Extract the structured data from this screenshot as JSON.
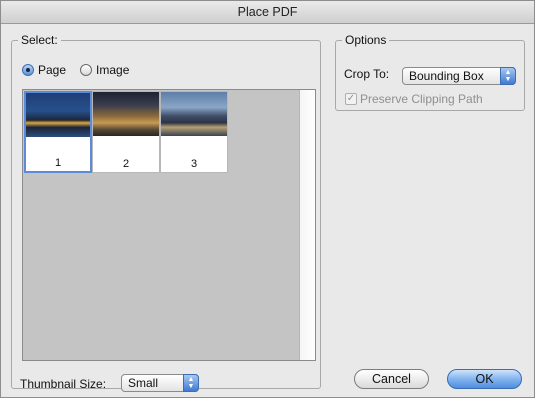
{
  "window": {
    "title": "Place PDF"
  },
  "select_group": {
    "legend": "Select:",
    "radio_page_label": "Page",
    "radio_image_label": "Image",
    "selected": "Page",
    "thumbnails": [
      {
        "page": "1",
        "selected": true
      },
      {
        "page": "2",
        "selected": false
      },
      {
        "page": "3",
        "selected": false
      }
    ],
    "thumbnail_size_label": "Thumbnail Size:",
    "thumbnail_size_value": "Small"
  },
  "options_group": {
    "legend": "Options",
    "crop_to_label": "Crop To:",
    "crop_to_value": "Bounding Box",
    "preserve_clipping_label": "Preserve Clipping Path",
    "preserve_clipping_checked": true,
    "preserve_clipping_enabled": false
  },
  "buttons": {
    "cancel": "Cancel",
    "ok": "OK"
  },
  "colors": {
    "accent": "#4e8fe0",
    "thumb_area_bg": "#c4c4c4"
  }
}
